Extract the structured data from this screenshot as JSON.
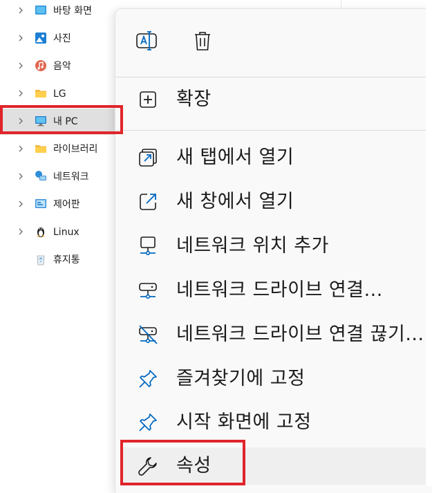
{
  "sidebar": {
    "items": [
      {
        "label": "바탕 화면",
        "icon": "desktop-icon"
      },
      {
        "label": "사진",
        "icon": "pictures-icon"
      },
      {
        "label": "음악",
        "icon": "music-icon"
      },
      {
        "label": "LG",
        "icon": "folder-icon"
      },
      {
        "label": "내 PC",
        "icon": "this-pc-icon",
        "selected": true
      },
      {
        "label": "라이브러리",
        "icon": "libraries-icon"
      },
      {
        "label": "네트워크",
        "icon": "network-icon"
      },
      {
        "label": "제어판",
        "icon": "control-panel-icon"
      },
      {
        "label": "Linux",
        "icon": "linux-icon"
      },
      {
        "label": "휴지통",
        "icon": "recycle-bin-icon"
      }
    ]
  },
  "context_menu": {
    "top_actions": [
      {
        "name": "rename",
        "icon": "rename-icon"
      },
      {
        "name": "delete",
        "icon": "trash-icon"
      }
    ],
    "items": [
      {
        "label": "확장",
        "icon": "expand-plus-icon"
      },
      {
        "label": "새 탭에서 열기",
        "icon": "open-new-tab-icon"
      },
      {
        "label": "새 창에서 열기",
        "icon": "open-new-window-icon"
      },
      {
        "label": "네트워크 위치 추가",
        "icon": "add-network-location-icon"
      },
      {
        "label": "네트워크 드라이브 연결...",
        "icon": "map-network-drive-icon"
      },
      {
        "label": "네트워크 드라이브 연결 끊기...",
        "icon": "disconnect-network-drive-icon"
      },
      {
        "label": "즐겨찾기에 고정",
        "icon": "pin-icon"
      },
      {
        "label": "시작 화면에 고정",
        "icon": "pin-icon"
      },
      {
        "label": "속성",
        "icon": "wrench-icon"
      }
    ]
  },
  "colors": {
    "highlight": "#e0242b",
    "accent": "#0067c0",
    "menu_background": "#f9f9f9",
    "selected_background": "#e0e0e0"
  }
}
